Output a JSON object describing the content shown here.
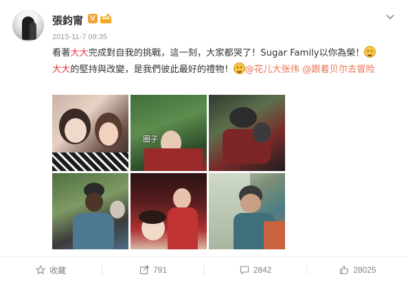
{
  "post": {
    "author": "張鈞甯",
    "verified_badge": "V",
    "timestamp": "2015-11-7 09:35",
    "text": {
      "seg1": "看著",
      "seg2_hl": "大大",
      "seg3": "完成對自我的挑戰，這一刻，大家都哭了！Sugar Family以你為榮！",
      "seg4_hl": "大大",
      "seg5": "的堅持與改變，是我們彼此最好的禮物！",
      "mention1": "@花儿大张伟",
      "mention2": "@跟着贝尔去冒险"
    },
    "photo_captions": {
      "p2": "圈子"
    }
  },
  "footer": {
    "favorite_label": "收藏",
    "repost_count": "791",
    "comment_count": "2842",
    "like_count": "28025"
  },
  "icons": {
    "menu": "chevron-down-icon",
    "favorite": "star-icon",
    "repost": "repost-icon",
    "comment": "comment-icon",
    "like": "thumbs-up-icon"
  },
  "colors": {
    "highlight": "#e4393c",
    "mention": "#eb7350",
    "muted": "#808080"
  }
}
